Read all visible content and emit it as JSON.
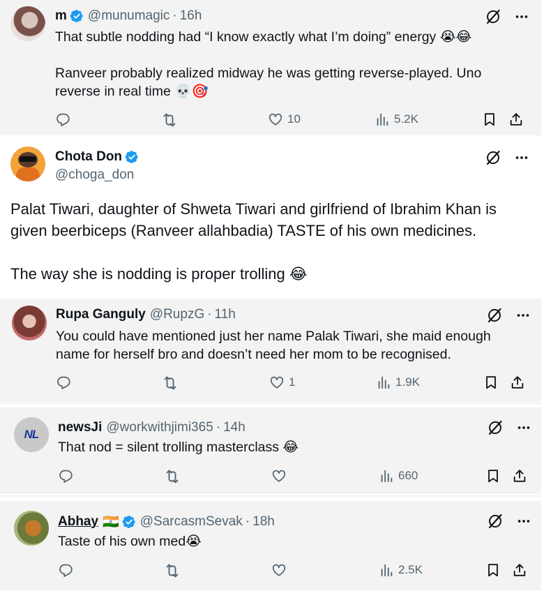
{
  "tweets": [
    {
      "name": "m",
      "handle": "@munumagic",
      "time": "16h",
      "text": "That subtle nodding had “I know exactly what I’m doing” energy 😭😂\n\nRanveer probably realized midway he was getting reverse-played. Uno reverse in real time 💀🎯",
      "likes": "10",
      "views": "5.2K"
    },
    {
      "name": "Chota Don",
      "handle": "@choga_don",
      "text": "Palat Tiwari, daughter of Shweta Tiwari and girlfriend of Ibrahim Khan is given beerbiceps (Ranveer allahbadia) TASTE of his own medicines.\n\nThe way she is nodding is proper trolling 😂"
    },
    {
      "name": "Rupa Ganguly",
      "handle": "@RupzG",
      "time": "11h",
      "text": "You could have mentioned just her name Palak Tiwari, she maid enough name for herself bro and doesn’t need her mom to be recognised.",
      "likes": "1",
      "views": "1.9K"
    },
    {
      "name": "newsJi",
      "handle": "@workwithjimi365",
      "time": "14h",
      "text": "That nod = silent trolling masterclass 😂",
      "likes": "",
      "views": "660",
      "avatar_text": "NL"
    },
    {
      "name": "Abhay",
      "flag": "🇮🇳",
      "handle": "@SarcasmSevak",
      "time": "18h",
      "text": "Taste of his own med😭",
      "likes": "",
      "views": "2.5K"
    }
  ],
  "dot": "·",
  "colors": {
    "verified": "#1d9bf0",
    "muted": "#536471",
    "text": "#0f1419"
  },
  "icons": [
    "verified-badge-icon",
    "grok-icon",
    "more-icon",
    "reply-icon",
    "retweet-icon",
    "like-icon",
    "views-icon",
    "bookmark-icon",
    "share-icon"
  ]
}
